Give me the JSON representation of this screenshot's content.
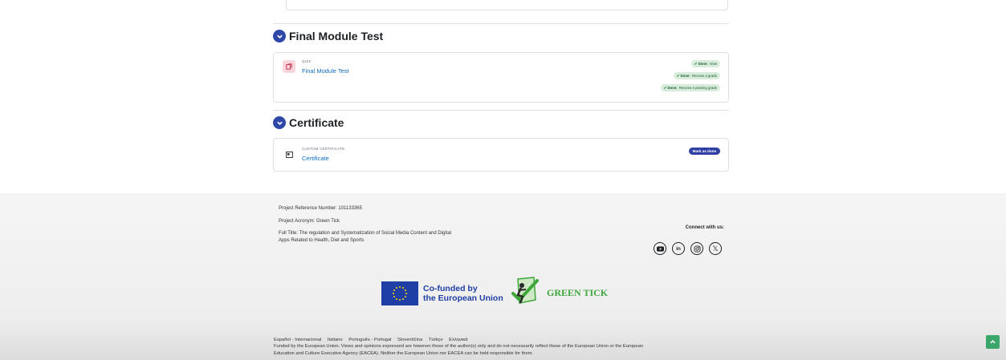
{
  "sections": [
    {
      "title": "Final Module Test",
      "activity": {
        "type": "QUIZ",
        "name": "Final Module Test",
        "icon": "quiz-icon",
        "completion": [
          {
            "label": "Done:",
            "detail": "View"
          },
          {
            "label": "Done:",
            "detail": "Receive a grade"
          },
          {
            "label": "Done:",
            "detail": "Receive a passing grade"
          }
        ]
      }
    },
    {
      "title": "Certificate",
      "activity": {
        "type": "CUSTOM CERTIFICATE",
        "name": "Certificate",
        "icon": "certificate-icon",
        "action": "Mark as done"
      }
    }
  ],
  "footer": {
    "project_ref": "Project Reference Number: 101133365",
    "project_acronym": "Project Acronym: Green Tick",
    "full_title_line1": "Full Title: The regulation and Systematization of Social Media Content and Digital",
    "full_title_line2": "Apps Related to Health, Diet and Sports",
    "connect": "Connect with us:",
    "social": [
      "youtube-icon",
      "linkedin-icon",
      "instagram-icon",
      "x-icon"
    ],
    "eu_line1": "Co-funded by",
    "eu_line2": "the European Union",
    "greentick": "GREEN TICK"
  },
  "languages": [
    "Español - Internacional",
    "Italiano",
    "Português - Portugal",
    "Slovenščina",
    "Türkçe",
    "Ελληνικά"
  ],
  "disclaimer_line1": "Funded by the European Union. Views and opinions expressed are however those of the author(s) only and do not necessarily reflect those of the European Union or the European",
  "disclaimer_line2": "Education and Culture Executive Agency (EACEA). Neither the European Union nor EACEA can be held responsible for them.",
  "colors": {
    "accent": "#2f48a8",
    "link": "#0f6cbf",
    "done_bg": "#d7ecdb",
    "green": "#3ea73a",
    "scroll_top": "#3aa66a"
  }
}
